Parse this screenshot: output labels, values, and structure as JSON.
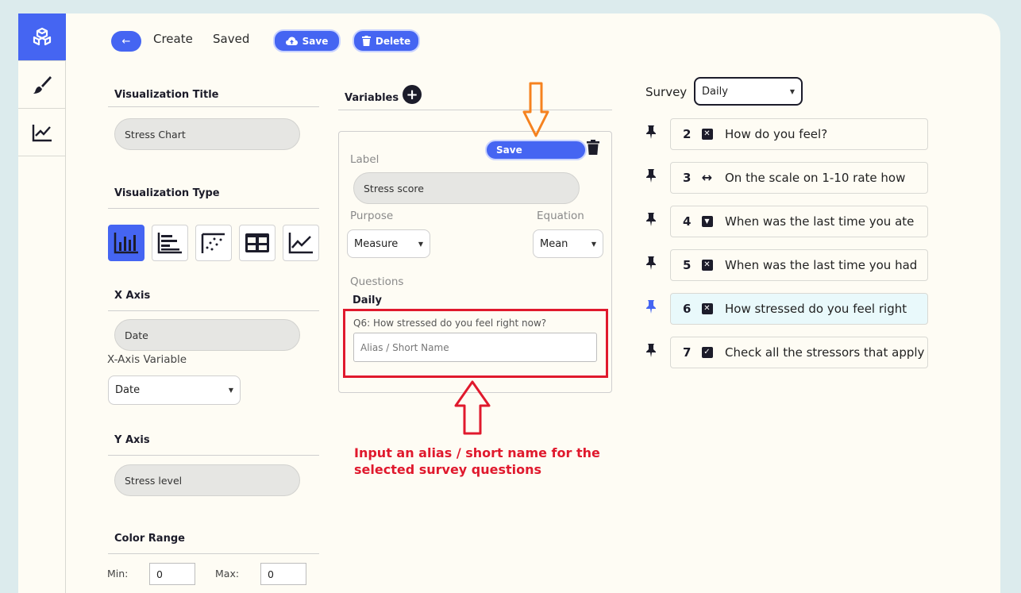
{
  "toolbar": {
    "back_label": "←",
    "create_label": "Create",
    "saved_label": "Saved",
    "save_label": "Save",
    "delete_label": "Delete"
  },
  "sidebar": {
    "items": [
      {
        "icon": "cubes-icon",
        "active": true
      },
      {
        "icon": "brush-icon",
        "active": false
      },
      {
        "icon": "line-chart-icon",
        "active": false
      }
    ]
  },
  "left": {
    "viz_title_heading": "Visualization Title",
    "viz_title_value": "Stress Chart",
    "viz_type_heading": "Visualization Type",
    "x_axis_heading": "X Axis",
    "x_axis_value": "Date",
    "x_axis_variable_label": "X-Axis Variable",
    "x_axis_variable_value": "Date",
    "y_axis_heading": "Y Axis",
    "y_axis_value": "Stress level",
    "color_range_heading": "Color Range",
    "min_label": "Min:",
    "min_value": "0",
    "max_label": "Max:",
    "max_value": "0"
  },
  "variables": {
    "heading": "Variables",
    "save_label": "Save",
    "label_label": "Label",
    "label_value": "Stress score",
    "purpose_label": "Purpose",
    "purpose_value": "Measure",
    "equation_label": "Equation",
    "equation_value": "Mean",
    "questions_label": "Questions",
    "survey_name": "Daily",
    "question_text": "Q6: How stressed do you feel right now?",
    "alias_placeholder": "Alias / Short Name"
  },
  "annotation": {
    "line1": "Input an alias / short name for the",
    "line2": "selected survey questions"
  },
  "survey": {
    "label": "Survey",
    "selected": "Daily",
    "questions": [
      {
        "num": "2",
        "icon": "x-box-icon",
        "text": "How do you feel?",
        "highlight": false
      },
      {
        "num": "3",
        "icon": "arrows-horizontal-icon",
        "text": "On the scale on 1-10 rate how",
        "highlight": false
      },
      {
        "num": "4",
        "icon": "dropdown-box-icon",
        "text": "When was the last time you ate",
        "highlight": false
      },
      {
        "num": "5",
        "icon": "x-box-icon",
        "text": "When was the last time you had",
        "highlight": false
      },
      {
        "num": "6",
        "icon": "x-box-icon",
        "text": "How stressed do you feel right",
        "highlight": true
      },
      {
        "num": "7",
        "icon": "check-box-icon",
        "text": "Check all the stressors that apply",
        "highlight": false
      }
    ]
  },
  "colors": {
    "accent": "#4565f2",
    "annotation_red": "#e0192d",
    "annotation_orange": "#f5821f",
    "highlight_row": "#e9f9fb"
  }
}
